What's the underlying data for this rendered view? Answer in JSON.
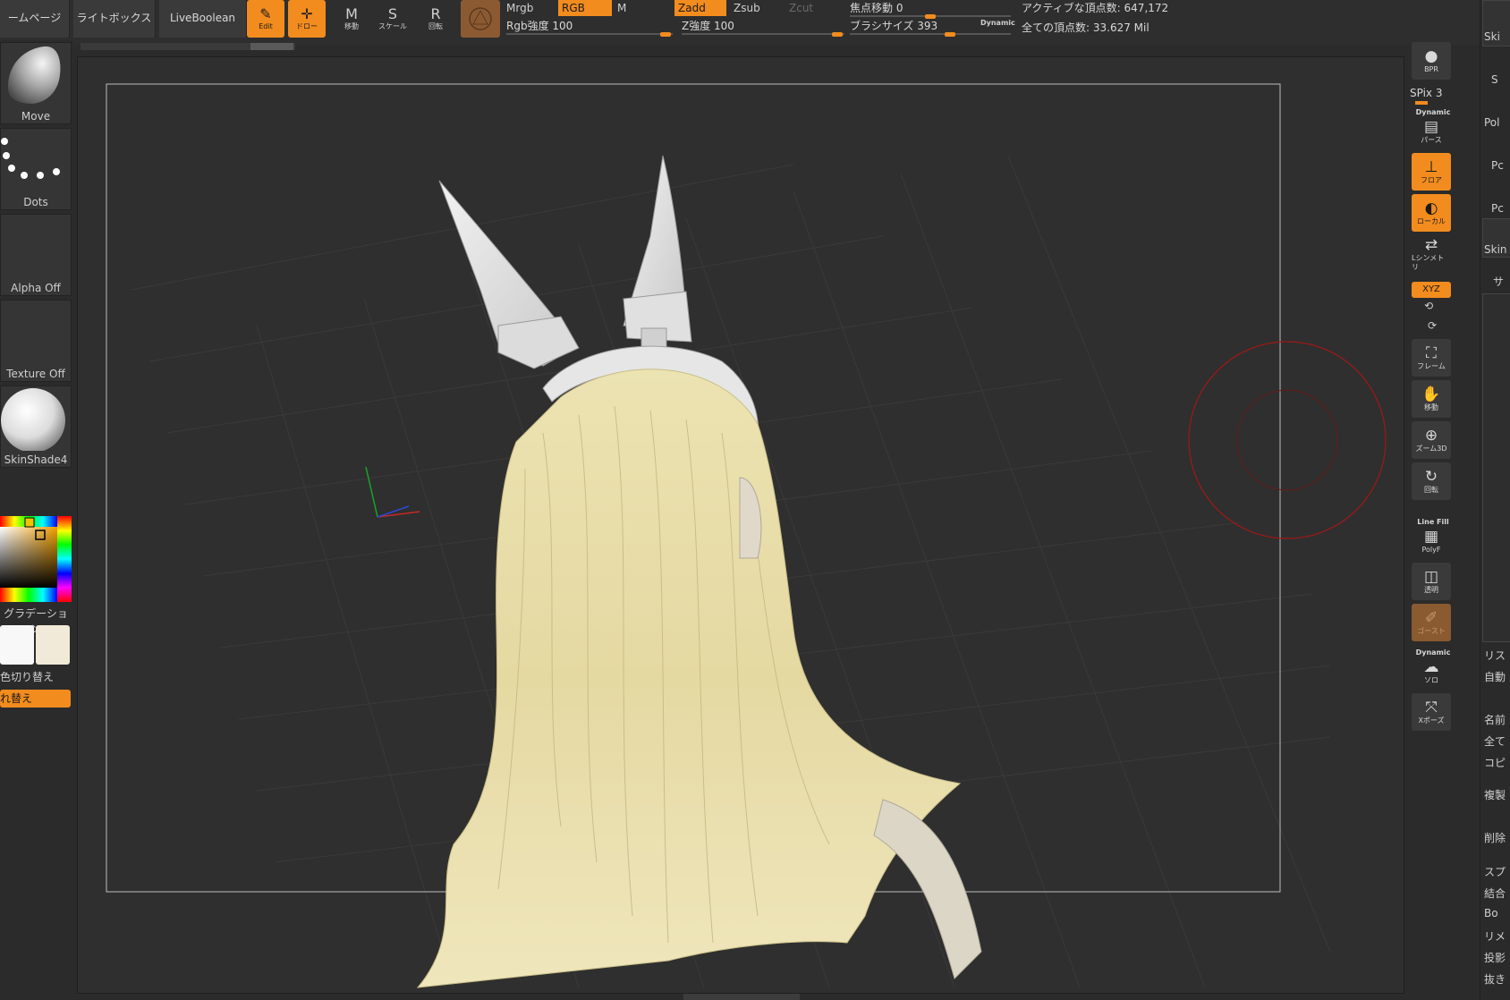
{
  "topbar": {
    "home_label": "ームページ",
    "lightbox_label": "ライトボックス",
    "liveboolean_label": "LiveBoolean",
    "tools": [
      {
        "key": "edit",
        "label": "Edit",
        "glyph": "✎",
        "active": true
      },
      {
        "key": "draw",
        "label": "ドロー",
        "glyph": "✛",
        "active": true
      },
      {
        "key": "move",
        "label": "移動",
        "glyph": "M",
        "active": false
      },
      {
        "key": "scale",
        "label": "スケール",
        "glyph": "S",
        "active": false
      },
      {
        "key": "rotate",
        "label": "回転",
        "glyph": "R",
        "active": false
      }
    ],
    "modes": {
      "mrgb": "Mrgb",
      "rgb": "RGB",
      "m": "M",
      "zadd": "Zadd",
      "zsub": "Zsub",
      "zcut": "Zcut"
    },
    "sliders": {
      "rgb_intensity": {
        "label": "Rgb強度 100",
        "value": 100
      },
      "z_intensity": {
        "label": "Z強度 100",
        "value": 100
      },
      "focal_shift": {
        "label": "焦点移動 0",
        "value": 0
      },
      "brush_size": {
        "label": "ブラシサイズ 393",
        "value": 393
      }
    },
    "dynamic_label": "Dynamic",
    "active_points": "アクティブな頂点数: 647,172",
    "total_points": "全ての頂点数: 33.627 Mil"
  },
  "leftshelf": {
    "brush_label": "Move",
    "stroke_label": "Dots",
    "alpha_label": "Alpha Off",
    "texture_label": "Texture Off",
    "material_label": "SkinShade4",
    "gradient_label": "グラデーション",
    "switch_label": "色切り替え",
    "swap_label": "れ替え",
    "colors": {
      "main": "#f8f8f8",
      "secondary": "#f2ead8",
      "accent": "#f28c1e"
    }
  },
  "rightshelf": {
    "bpr_label": "BPR",
    "spix_label": "SPix 3",
    "dynamic_label": "Dynamic",
    "persp_label": "パース",
    "floor_label": "フロア",
    "local_label": "ローカル",
    "sym_label": "Lシンメトリ",
    "xyz_label": "XYZ",
    "frame_label": "フレーム",
    "move_label": "移動",
    "zoom_label": "ズーム3D",
    "rotate_label": "回転",
    "linefill_top": "Line Fill",
    "polyf_label": "PolyF",
    "transp_label": "透明",
    "ghost_label": "ゴースト",
    "dynamic2_label": "Dynamic",
    "solo_label": "ソロ",
    "xpose_label": "Xポーズ"
  },
  "tray": {
    "items": [
      "Ski",
      "S",
      "Pol",
      "Pc",
      "Pc",
      "Skin",
      "サ",
      "リス",
      "自動",
      "名前",
      "全て",
      "コピ",
      "複製",
      "削除",
      "スプ",
      "結合",
      "Bo",
      "リメ",
      "投影",
      "抜き"
    ]
  }
}
